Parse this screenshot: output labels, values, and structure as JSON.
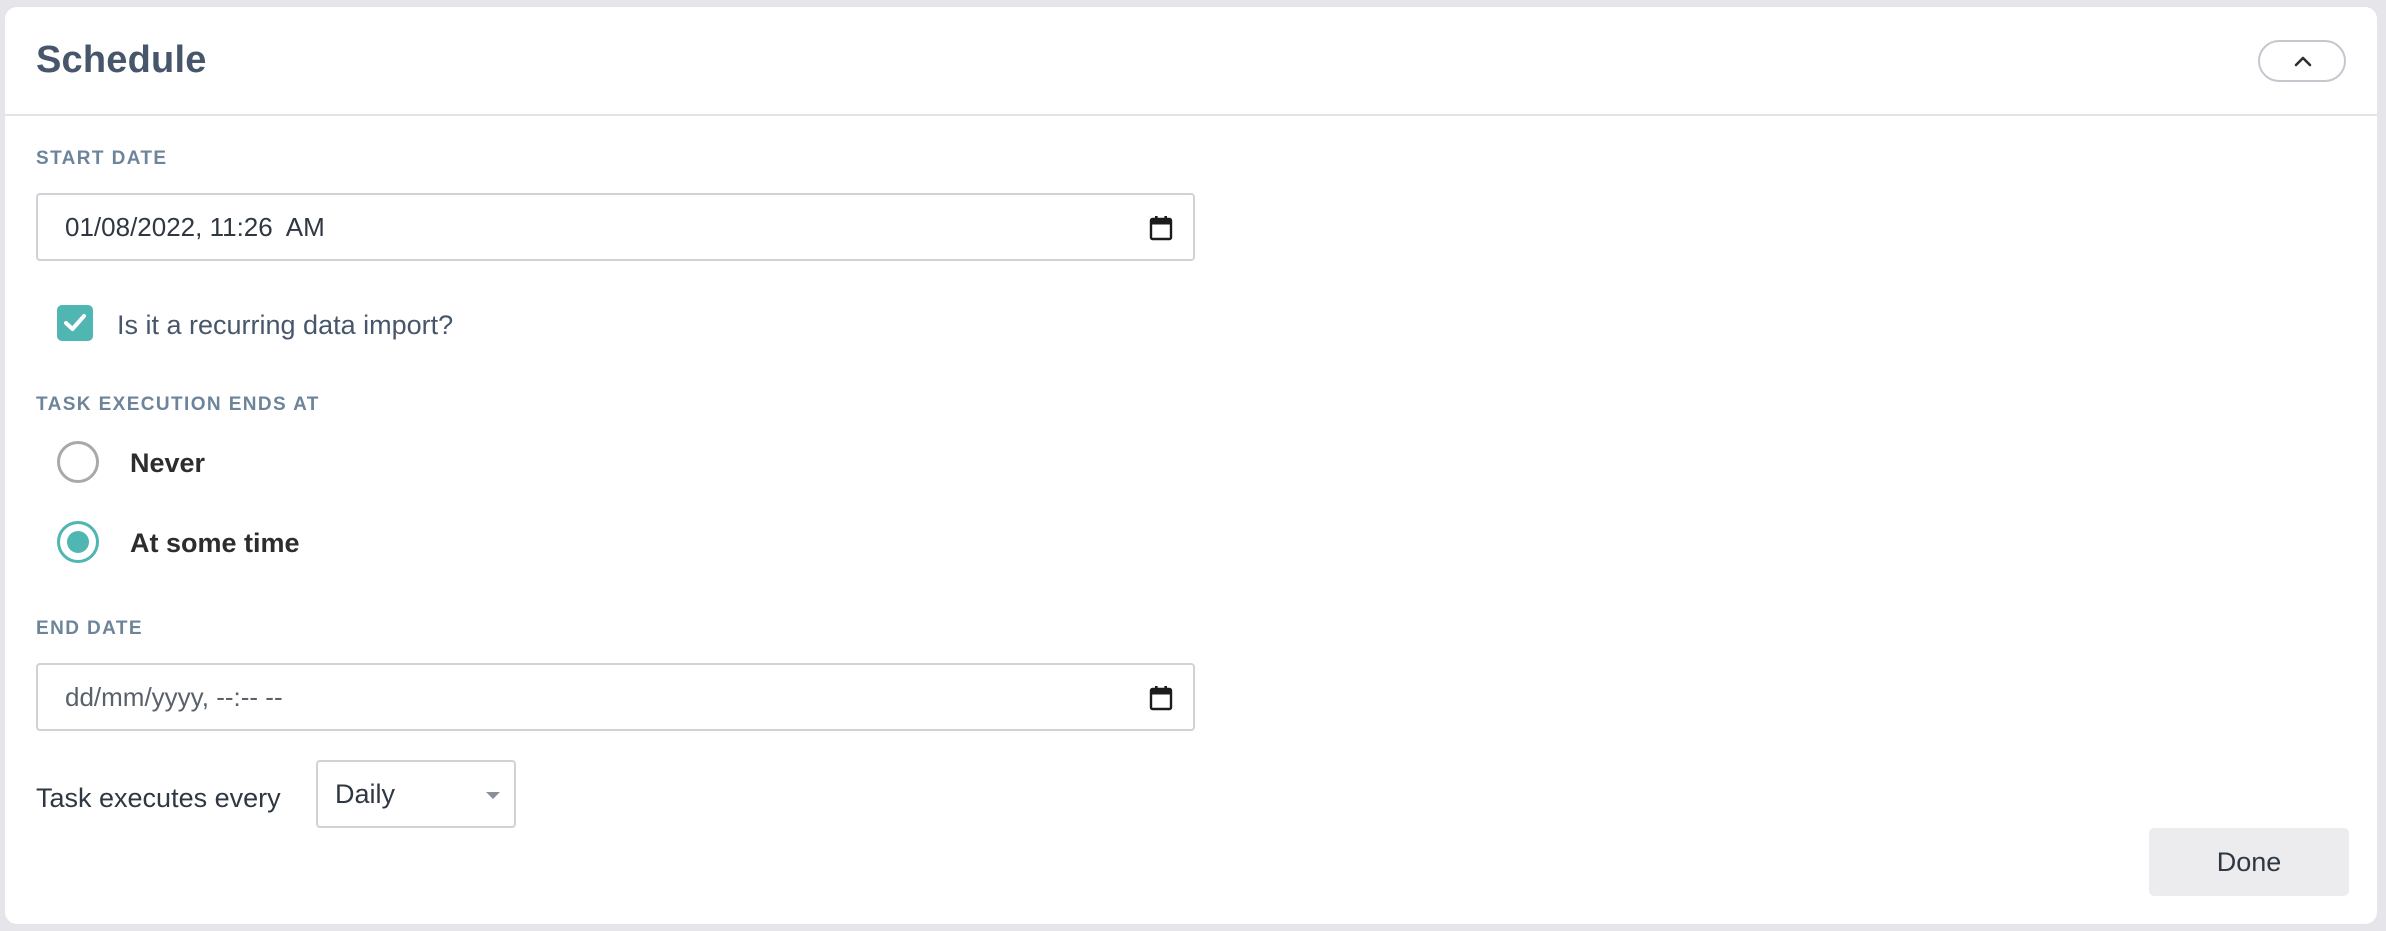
{
  "header": {
    "title": "Schedule",
    "collapse_icon": "chevron-up-icon"
  },
  "start_date": {
    "label": "START DATE",
    "value": "01/08/2022, 11:26  AM",
    "icon": "calendar-icon"
  },
  "recurring": {
    "label": "Is it a recurring data import?",
    "checked": true
  },
  "task_end": {
    "label": "TASK EXECUTION ENDS AT",
    "options": [
      {
        "label": "Never",
        "selected": false
      },
      {
        "label": "At some time",
        "selected": true
      }
    ]
  },
  "end_date": {
    "label": "END DATE",
    "placeholder": "dd/mm/yyyy, --:-- --",
    "icon": "calendar-icon"
  },
  "frequency": {
    "label": "Task executes every",
    "selected": "Daily"
  },
  "footer": {
    "done_label": "Done"
  },
  "colors": {
    "accent": "#4fb6b2",
    "title": "#47566a",
    "section_label": "#6e849a",
    "button_bg": "#ececee"
  }
}
